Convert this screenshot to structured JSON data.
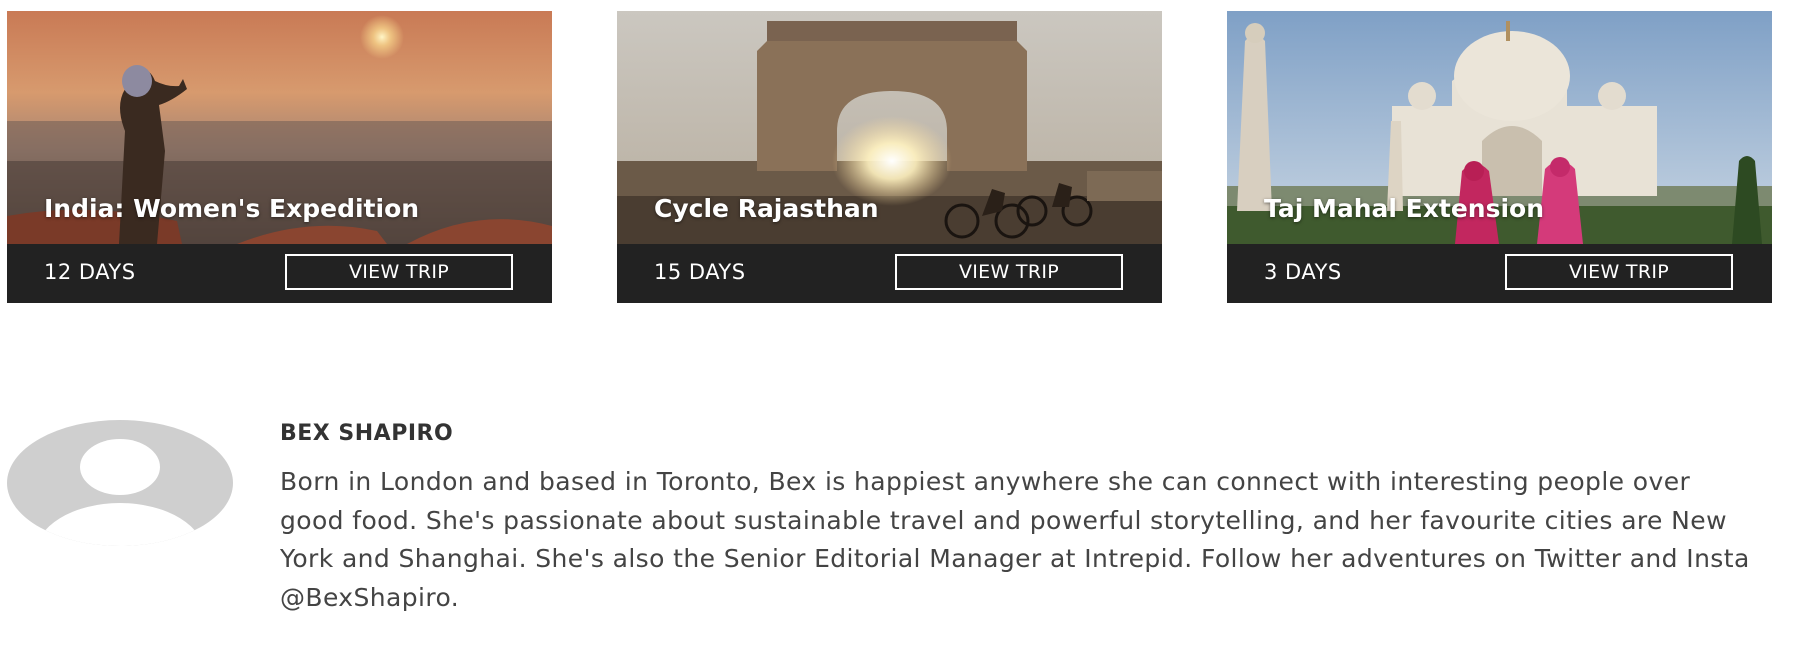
{
  "trips": [
    {
      "title": "India: Women's Expedition",
      "duration": "12 DAYS",
      "button_label": "VIEW TRIP"
    },
    {
      "title": "Cycle Rajasthan",
      "duration": "15 DAYS",
      "button_label": "VIEW TRIP"
    },
    {
      "title": "Taj Mahal Extension",
      "duration": "3 DAYS",
      "button_label": "VIEW TRIP"
    }
  ],
  "author": {
    "name": "BEX SHAPIRO",
    "bio": "Born in London and based in Toronto, Bex is happiest anywhere she can connect with interesting people over good food. She's passionate about sustainable travel and powerful storytelling, and her favourite cities are New York and Shanghai. She's also the Senior Editorial Manager at Intrepid. Follow her adventures on Twitter and Insta @BexShapiro."
  },
  "colors": {
    "card_bar": "#222222",
    "text_white": "#ffffff",
    "avatar_gray": "#cfcfcf",
    "name_text": "#333333",
    "bio_text": "#444444"
  }
}
